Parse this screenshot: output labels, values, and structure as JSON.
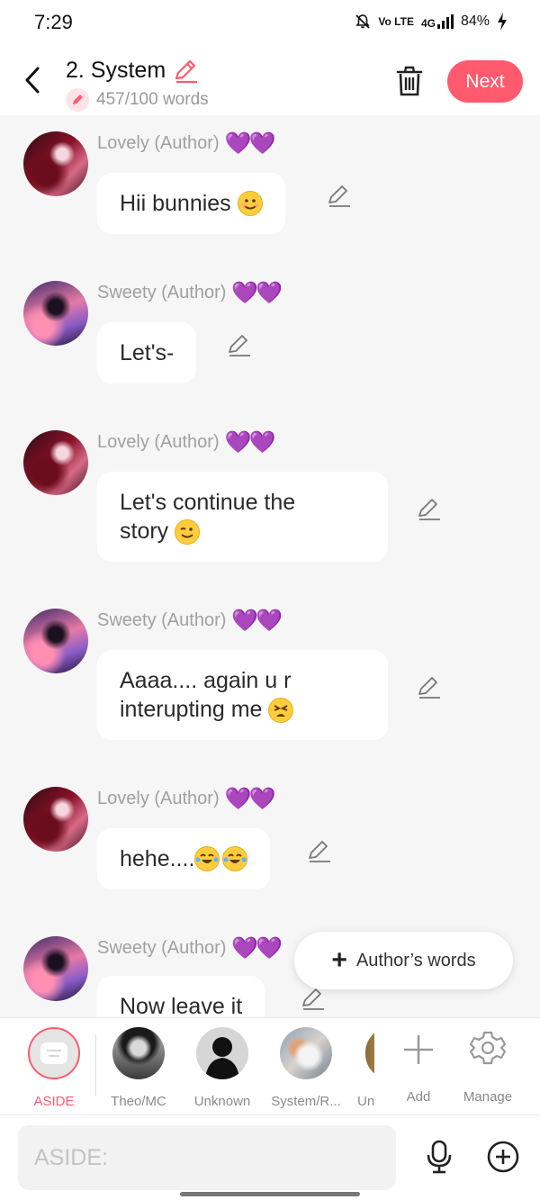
{
  "status_bar": {
    "time": "7:29",
    "network": "Vo LTE",
    "signal": "4G",
    "battery": "84%"
  },
  "header": {
    "title": "2. System",
    "word_count": "457/100 words",
    "next_label": "Next"
  },
  "messages": [
    {
      "author": "Lovely (Author)",
      "hearts": "💜💜",
      "avatar": "lovely",
      "text": "Hii bunnies",
      "emoji": "smiling-face"
    },
    {
      "author": "Sweety (Author)",
      "hearts": "💜💜",
      "avatar": "sweety",
      "text": "Let's-"
    },
    {
      "author": "Lovely (Author)",
      "hearts": "💜💜",
      "avatar": "lovely",
      "line1": "Let's continue the",
      "line2": "story",
      "emoji": "winking-face"
    },
    {
      "author": "Sweety (Author)",
      "hearts": "💜💜",
      "avatar": "sweety",
      "line1": "Aaaa.... again u r",
      "line2": "interupting me",
      "emoji": "tired-face"
    },
    {
      "author": "Lovely (Author)",
      "hearts": "💜💜",
      "avatar": "lovely",
      "text": "hehe....",
      "emoji": "tears-of-joy-x2"
    },
    {
      "author": "Sweety (Author)",
      "hearts": "💜💜",
      "avatar": "sweety",
      "text": "Now leave it"
    }
  ],
  "fab": {
    "label": "Author’s words"
  },
  "characters": [
    {
      "label": "ASIDE",
      "selected": true
    },
    {
      "label": "Theo/MC"
    },
    {
      "label": "Unknown"
    },
    {
      "label": "System/R..."
    },
    {
      "label": "Un"
    }
  ],
  "actions": {
    "add": "Add",
    "manage": "Manage"
  },
  "composer": {
    "placeholder": "ASIDE:",
    "value": ""
  },
  "colors": {
    "accent": "#ff5a6e",
    "heart": "#a23ee0",
    "background": "#f6f6f6"
  }
}
